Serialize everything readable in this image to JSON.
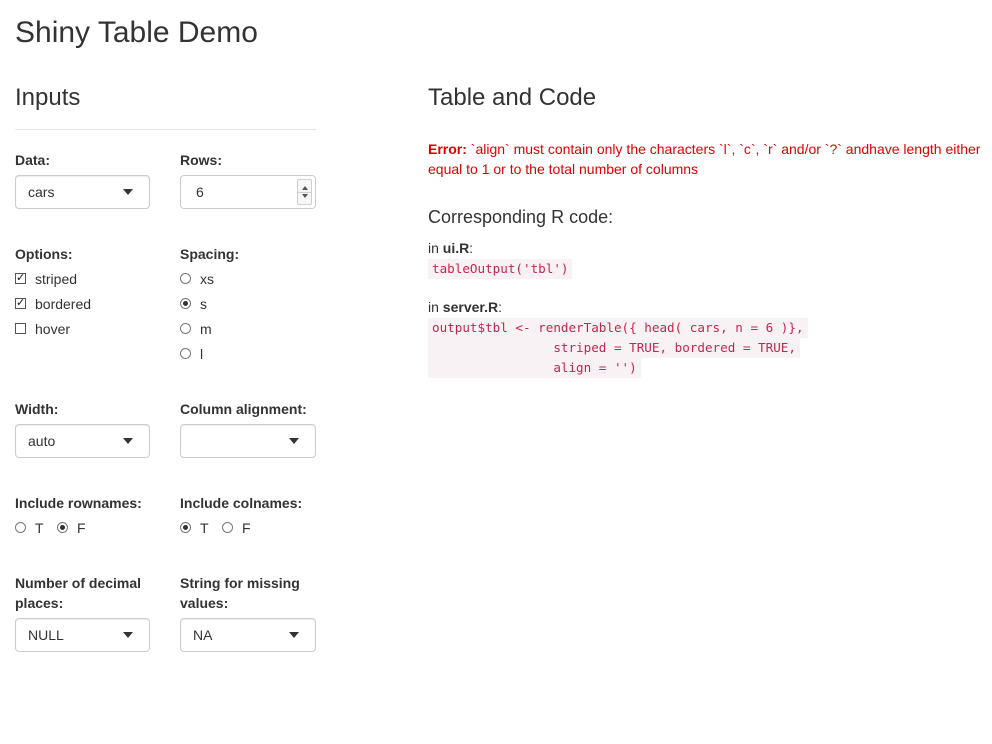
{
  "app_title": "Shiny Table Demo",
  "inputs_heading": "Inputs",
  "output_heading": "Table and Code",
  "data_input": {
    "label": "Data:",
    "value": "cars"
  },
  "rows_input": {
    "label": "Rows:",
    "value": "6"
  },
  "options_input": {
    "label": "Options:",
    "items": [
      {
        "label": "striped",
        "checked": true
      },
      {
        "label": "bordered",
        "checked": true
      },
      {
        "label": "hover",
        "checked": false
      }
    ]
  },
  "spacing_input": {
    "label": "Spacing:",
    "items": [
      {
        "label": "xs",
        "selected": false
      },
      {
        "label": "s",
        "selected": true
      },
      {
        "label": "m",
        "selected": false
      },
      {
        "label": "l",
        "selected": false
      }
    ]
  },
  "width_input": {
    "label": "Width:",
    "value": "auto"
  },
  "column_alignment_input": {
    "label": "Column alignment:",
    "value": ""
  },
  "rownames_input": {
    "label": "Include rownames:",
    "items": [
      {
        "label": "T",
        "selected": false
      },
      {
        "label": "F",
        "selected": true
      }
    ]
  },
  "colnames_input": {
    "label": "Include colnames:",
    "items": [
      {
        "label": "T",
        "selected": true
      },
      {
        "label": "F",
        "selected": false
      }
    ]
  },
  "decimal_places_input": {
    "label_line1": "Number of decimal",
    "label_line2": "places:",
    "value": "NULL"
  },
  "missing_values_input": {
    "label_line1": "String for missing",
    "label_line2": "values:",
    "value": "NA"
  },
  "error_message": {
    "prefix": "Error:",
    "line1": " `align` must contain only the characters `l`, `c`, `r` and/or `?` andhave length either",
    "line2": "equal to 1 or to the total number of columns"
  },
  "code_section": {
    "heading": "Corresponding R code:",
    "ui_prefix": "in ",
    "ui_file": "ui.R",
    "ui_suffix": ":",
    "ui_code": "tableOutput('tbl')",
    "server_prefix": "in ",
    "server_file": "server.R",
    "server_suffix": ":",
    "server_code_line1": "output$tbl <- renderTable({ head( cars, n = 6 )},",
    "server_code_line2": "                striped = TRUE, bordered = TRUE,",
    "server_code_line3": "                align = '')"
  },
  "colors": {
    "error": "#e00000",
    "code_text": "#c7254e",
    "code_bg": "#f9f2f4"
  }
}
